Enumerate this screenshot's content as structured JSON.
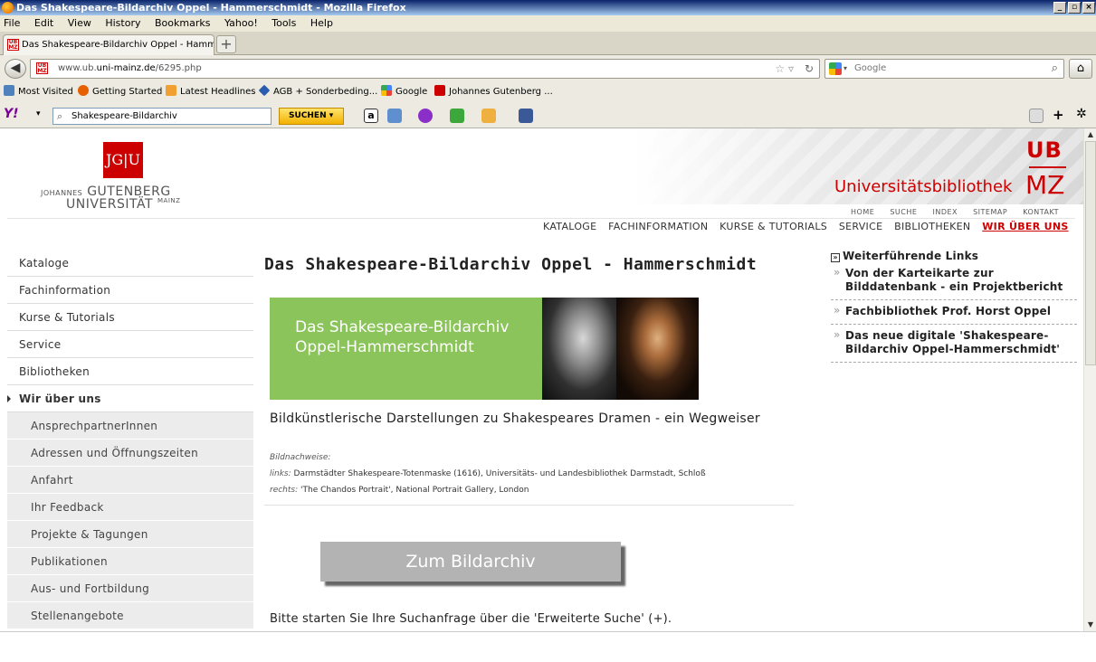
{
  "window": {
    "title": "Das Shakespeare-Bildarchiv Oppel - Hammerschmidt - Mozilla Firefox",
    "controls": [
      "_",
      "▫",
      "×"
    ]
  },
  "menu": [
    "File",
    "Edit",
    "View",
    "History",
    "Bookmarks",
    "Yahoo!",
    "Tools",
    "Help"
  ],
  "tabs": [
    {
      "label": "Das Shakespeare-Bildarchiv Oppel - Hammer..."
    }
  ],
  "address": {
    "url_prefix": "www.ub.",
    "url_domain": "uni-mainz.de",
    "url_path": "/6295.php"
  },
  "search": {
    "placeholder": "Google"
  },
  "bookmarks": [
    "Most Visited",
    "Getting Started",
    "Latest Headlines",
    "AGB + Sonderbeding...",
    "Google",
    "Johannes Gutenberg ..."
  ],
  "yahoo": {
    "search_value": "Shakespeare-Bildarchiv",
    "search_button": "SUCHEN"
  },
  "header": {
    "jgu_logo": "JG|U",
    "jgu_name_small": "JOHANNES",
    "jgu_name1": "GUTENBERG",
    "jgu_name2": "UNIVERSITÄT",
    "jgu_name2_small": "MAINZ",
    "ub_short": "UB",
    "ub_title": "Universitätsbibliothek",
    "ub_mz": "MZ",
    "top_links": [
      "HOME",
      "SUCHE",
      "INDEX",
      "SITEMAP",
      "KONTAKT"
    ],
    "main_nav": [
      "KATALOGE",
      "FACHINFORMATION",
      "KURSE & TUTORIALS",
      "SERVICE",
      "BIBLIOTHEKEN",
      "WIR ÜBER UNS"
    ]
  },
  "sidebar": {
    "items": [
      "Kataloge",
      "Fachinformation",
      "Kurse & Tutorials",
      "Service",
      "Bibliotheken",
      "Wir über uns"
    ],
    "sub_items": [
      "AnsprechpartnerInnen",
      "Adressen und Öffnungszeiten",
      "Anfahrt",
      "Ihr Feedback",
      "Projekte & Tagungen",
      "Publikationen",
      "Aus- und Fortbildung",
      "Stellenangebote"
    ]
  },
  "main": {
    "title": "Das Shakespeare-Bildarchiv Oppel - Hammerschmidt",
    "banner_line1": "Das Shakespeare-Bildarchiv",
    "banner_line2": "Oppel-Hammerschmidt",
    "subtitle": "Bildkünstlerische Darstellungen zu Shakespeares Dramen - ein Wegweiser",
    "credits_label": "Bildnachweise:",
    "credits_left_label": "links:",
    "credits_left": "Darmstädter Shakespeare-Totenmaske (1616), Universitäts- und Landesbibliothek Darmstadt, Schloß",
    "credits_right_label": "rechts:",
    "credits_right": "'The Chandos Portrait', National Portrait Gallery, London",
    "archive_button": "Zum Bildarchiv",
    "hint": "Bitte starten Sie Ihre Suchanfrage über die 'Erweiterte Suche' (+)."
  },
  "rightcol": {
    "heading": "Weiterführende Links",
    "links": [
      "Von der Karteikarte zur Bilddatenbank - ein Projektbericht",
      "Fachbibliothek Prof. Horst Oppel",
      "Das neue digitale 'Shakespeare-Bildarchiv Oppel-Hammerschmidt'"
    ]
  }
}
